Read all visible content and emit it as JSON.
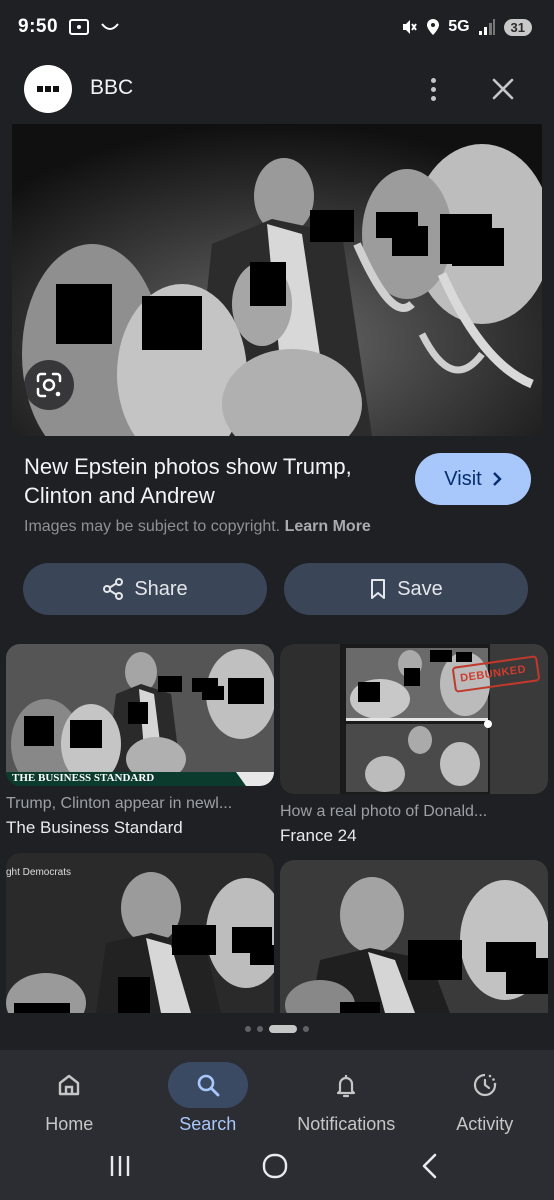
{
  "status": {
    "time": "9:50",
    "network": "5G",
    "battery": "31"
  },
  "header": {
    "source": "BBC"
  },
  "result": {
    "title": "New Epstein photos show Trump, Clinton and Andrew",
    "visit_label": "Visit",
    "copyright_text": "Images may be subject to copyright.",
    "learn_more": "Learn More"
  },
  "actions": {
    "share": "Share",
    "save": "Save"
  },
  "related": [
    {
      "title": "Trump, Clinton appear in newl...",
      "source": "The Business Standard",
      "banner": "THE BUSINESS STANDARD"
    },
    {
      "title": "How a real photo of Donald...",
      "source": "France 24",
      "stamp": "DEBUNKED"
    },
    {
      "caption": "ght Democrats"
    },
    {}
  ],
  "nav": [
    {
      "label": "Home",
      "icon": "home-icon"
    },
    {
      "label": "Search",
      "icon": "search-icon",
      "active": true
    },
    {
      "label": "Notifications",
      "icon": "bell-icon"
    },
    {
      "label": "Activity",
      "icon": "activity-icon"
    }
  ]
}
